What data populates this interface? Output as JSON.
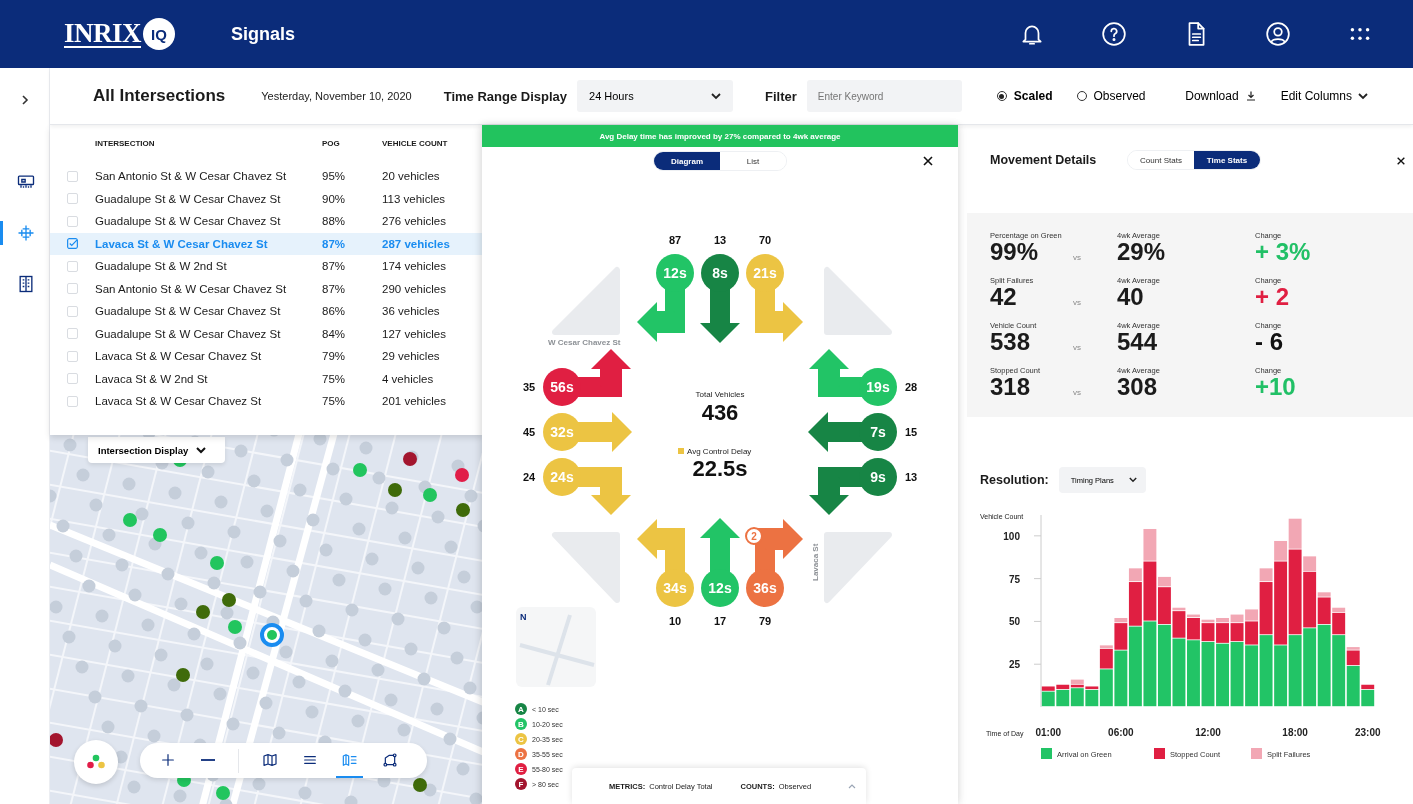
{
  "header": {
    "logo": {
      "word": "INRIX",
      "badge": "IQ"
    },
    "title": "Signals"
  },
  "sidebar": {
    "items": [
      {
        "selected": false
      },
      {
        "selected": true
      },
      {
        "selected": false
      }
    ]
  },
  "toolbar": {
    "title": "All Intersections",
    "date": "Yesterday, November 10, 2020",
    "time_range_label": "Time Range Display",
    "time_range_value": "24 Hours",
    "filter_label": "Filter",
    "filter_placeholder": "Enter Keyword",
    "modes": [
      {
        "label": "Scaled",
        "selected": true
      },
      {
        "label": "Observed",
        "selected": false
      }
    ],
    "download": "Download",
    "edit_columns": "Edit Columns"
  },
  "table": {
    "columns": [
      "INTERSECTION",
      "POG",
      "VEHICLE COUNT"
    ],
    "rows": [
      {
        "intersection": "San Antonio St & W Cesar Chavez St",
        "pog": "95%",
        "vehicle_count": "20 vehicles",
        "checked": false
      },
      {
        "intersection": "Guadalupe St & W Cesar Chavez St",
        "pog": "90%",
        "vehicle_count": "113 vehicles",
        "checked": false
      },
      {
        "intersection": "Guadalupe St & W Cesar Chavez St",
        "pog": "88%",
        "vehicle_count": "276 vehicles",
        "checked": false
      },
      {
        "intersection": "Lavaca St & W Cesar Chavez St",
        "pog": "87%",
        "vehicle_count": "287 vehicles",
        "checked": true
      },
      {
        "intersection": "Guadalupe St & W 2nd St",
        "pog": "87%",
        "vehicle_count": "174 vehicles",
        "checked": false
      },
      {
        "intersection": "San Antonio St & W Cesar Chavez St",
        "pog": "87%",
        "vehicle_count": "290 vehicles",
        "checked": false
      },
      {
        "intersection": "Guadalupe St & W Cesar Chavez St",
        "pog": "86%",
        "vehicle_count": "36 vehicles",
        "checked": false
      },
      {
        "intersection": "Guadalupe St & W Cesar Chavez St",
        "pog": "84%",
        "vehicle_count": "127 vehicles",
        "checked": false
      },
      {
        "intersection": "Lavaca St & W Cesar Chavez St",
        "pog": "79%",
        "vehicle_count": "29 vehicles",
        "checked": false
      },
      {
        "intersection": "Lavaca St & W 2nd St",
        "pog": "75%",
        "vehicle_count": "4 vehicles",
        "checked": false
      },
      {
        "intersection": "Lavaca St & W Cesar Chavez St",
        "pog": "75%",
        "vehicle_count": "201 vehicles",
        "checked": false
      }
    ]
  },
  "map": {
    "display_menu": "Intersection Display",
    "tools": [
      {
        "kind": "zoom_in",
        "selected": false
      },
      {
        "kind": "zoom_out",
        "selected": false
      },
      {
        "kind": "map",
        "selected": false
      },
      {
        "kind": "list",
        "selected": false
      },
      {
        "kind": "split",
        "selected": true
      },
      {
        "kind": "route",
        "selected": false
      }
    ]
  },
  "diagram_panel": {
    "banner": "Avg Delay time has improved by 27% compared to 4wk average",
    "views": [
      {
        "label": "Diagram",
        "selected": true
      },
      {
        "label": "List",
        "selected": false
      }
    ],
    "streets": {
      "west": "W Cesar Chavez St",
      "south": "Lavaca St"
    },
    "north": [
      {
        "kind": "right",
        "delay": "12s",
        "count": "87",
        "color": "#22c466"
      },
      {
        "kind": "through",
        "delay": "8s",
        "count": "13",
        "color": "#178545"
      },
      {
        "kind": "left",
        "delay": "21s",
        "count": "70",
        "color": "#ecc443"
      }
    ],
    "west": [
      {
        "kind": "left",
        "delay": "56s",
        "count": "35",
        "color": "#e01f42"
      },
      {
        "kind": "through",
        "delay": "32s",
        "count": "45",
        "color": "#ecc443"
      },
      {
        "kind": "right",
        "delay": "24s",
        "count": "24",
        "color": "#ecc443"
      }
    ],
    "east": [
      {
        "kind": "right",
        "delay": "19s",
        "count": "28",
        "color": "#22c466"
      },
      {
        "kind": "through",
        "delay": "7s",
        "count": "15",
        "color": "#178545"
      },
      {
        "kind": "left",
        "delay": "9s",
        "count": "13",
        "color": "#178545"
      }
    ],
    "south": [
      {
        "kind": "left",
        "delay": "34s",
        "count": "10",
        "color": "#ecc443"
      },
      {
        "kind": "through",
        "delay": "12s",
        "count": "17",
        "color": "#22c466"
      },
      {
        "kind": "right",
        "delay": "36s",
        "count": "79",
        "color": "#ec7242",
        "badge": "2"
      }
    ],
    "total_label": "Total Vehicles",
    "total": "436",
    "delay_label": "Avg Control Delay",
    "delay": "22.5s",
    "compass": "N",
    "legend": [
      {
        "grade": "A",
        "label": "< 10 sec",
        "color": "#178545"
      },
      {
        "grade": "B",
        "label": "10-20 sec",
        "color": "#22c466"
      },
      {
        "grade": "C",
        "label": "20-35 sec",
        "color": "#ecc443"
      },
      {
        "grade": "D",
        "label": "35-55 sec",
        "color": "#ec7242"
      },
      {
        "grade": "E",
        "label": "55-80 sec",
        "color": "#e01f42"
      },
      {
        "grade": "F",
        "label": "> 80 sec",
        "color": "#a3152e"
      }
    ],
    "metrics": {
      "metrics_label": "METRICS:",
      "metrics_value": "Control Delay Total",
      "counts_label": "COUNTS:",
      "counts_value": "Observed"
    }
  },
  "movement_details": {
    "title": "Movement Details",
    "views": [
      {
        "label": "Count Stats",
        "selected": false
      },
      {
        "label": "Time Stats",
        "selected": true
      }
    ],
    "stats": [
      {
        "label": "Percentage on Green",
        "value": "99%",
        "vs": "vs",
        "average_label": "4wk Average",
        "average": "29%",
        "change_label": "Change",
        "change": "+ 3%",
        "color": "#21c066"
      },
      {
        "label": "Split Failures",
        "value": "42",
        "vs": "vs",
        "average_label": "4wk Average",
        "average": "40",
        "change_label": "Change",
        "change": "+ 2",
        "color": "#e01f42"
      },
      {
        "label": "Vehicle Count",
        "value": "538",
        "vs": "vs",
        "average_label": "4wk Average",
        "average": "544",
        "change_label": "Change",
        "change": "- 6",
        "color": "#111111"
      },
      {
        "label": "Stopped Count",
        "value": "318",
        "vs": "vs",
        "average_label": "4wk Average",
        "average": "308",
        "change_label": "Change",
        "change": "+10",
        "color": "#21c066"
      }
    ],
    "resolution_label": "Resolution:",
    "resolution": "Timing Plans",
    "chart_data": {
      "type": "bar",
      "stacked": true,
      "xlabel": "Time of Day",
      "ylabel": "Vehicle Count",
      "categories": [
        "01:00",
        null,
        null,
        null,
        null,
        "06:00",
        null,
        null,
        null,
        null,
        null,
        "12:00",
        null,
        null,
        null,
        null,
        null,
        "18:00",
        null,
        null,
        null,
        null,
        "23:00"
      ],
      "yticks": [
        25,
        50,
        75,
        100
      ],
      "ylim": [
        0,
        111
      ],
      "legend": "bottom",
      "series": [
        {
          "name": "Arrival on Green",
          "color": "#22c466",
          "values": [
            9,
            10,
            11,
            10,
            22,
            33,
            47,
            50,
            48,
            40,
            39,
            38,
            37,
            38,
            36,
            42,
            36,
            42,
            46,
            48,
            42,
            24,
            10
          ]
        },
        {
          "name": "Stopped Count",
          "color": "#e01f42",
          "values": [
            3,
            3,
            2,
            2,
            12,
            16,
            26,
            35,
            22,
            16,
            13,
            11,
            12,
            11,
            14,
            31,
            49,
            50,
            33,
            16,
            13,
            9,
            3
          ]
        },
        {
          "name": "Split Failures",
          "color": "#f2a7b4",
          "values": [
            null,
            null,
            3,
            null,
            2,
            3,
            8,
            19,
            6,
            2,
            2,
            2,
            3,
            5,
            7,
            8,
            12,
            18,
            9,
            3,
            3,
            2,
            null
          ]
        }
      ]
    }
  }
}
